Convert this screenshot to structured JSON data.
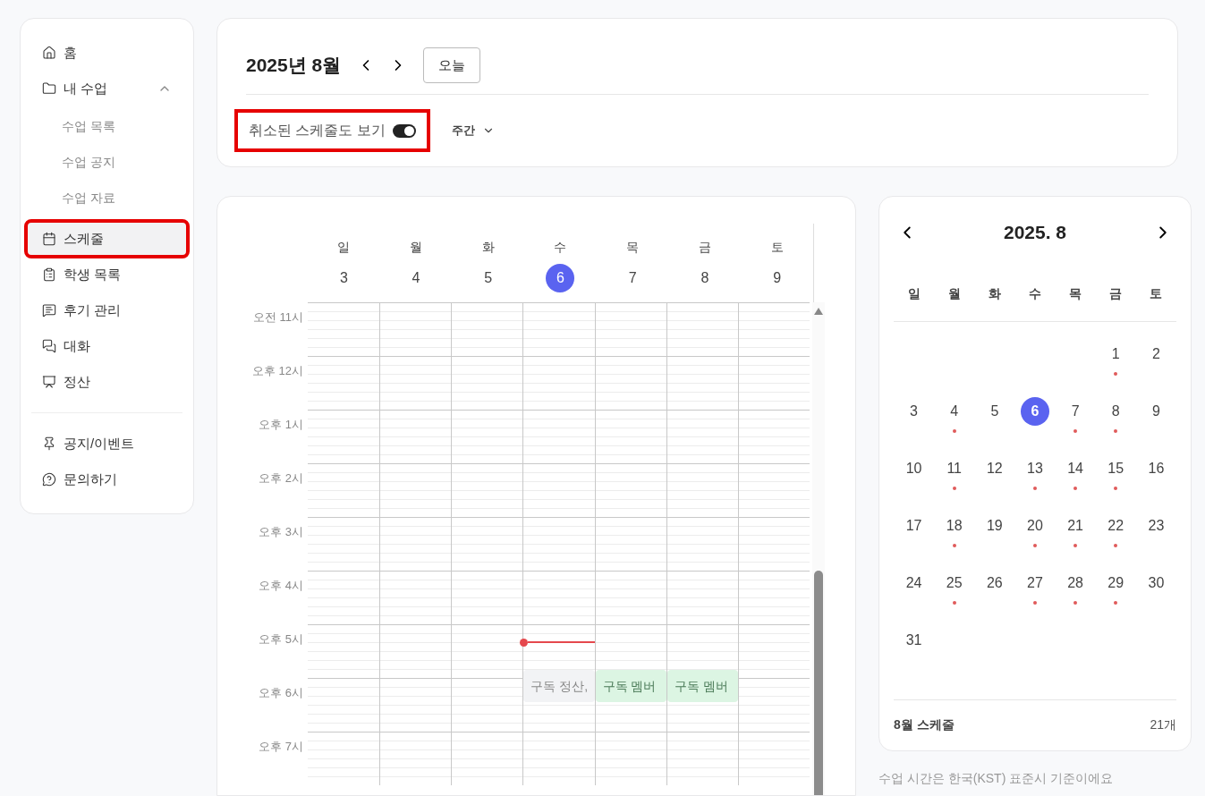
{
  "sidebar": {
    "items": [
      {
        "label": "홈",
        "selected": false,
        "highlighted": false
      },
      {
        "label": "내 수업",
        "selected": false,
        "highlighted": false,
        "expanded": true,
        "children": [
          {
            "label": "수업 목록"
          },
          {
            "label": "수업 공지"
          },
          {
            "label": "수업 자료"
          }
        ]
      },
      {
        "label": "스케줄",
        "selected": true,
        "highlighted": true
      },
      {
        "label": "학생 목록",
        "selected": false,
        "highlighted": false
      },
      {
        "label": "후기 관리",
        "selected": false,
        "highlighted": false
      },
      {
        "label": "대화",
        "selected": false,
        "highlighted": false
      },
      {
        "label": "정산",
        "selected": false,
        "highlighted": false
      }
    ],
    "bottom_items": [
      {
        "label": "공지/이벤트",
        "selected": false
      },
      {
        "label": "문의하기",
        "selected": false
      }
    ]
  },
  "toolbar": {
    "title": "2025년 8월",
    "today_button": "오늘",
    "cancelled_toggle": {
      "label": "취소된 스케줄도 보기",
      "on": true,
      "highlighted": true
    },
    "view_select": "주간"
  },
  "week": {
    "days": [
      {
        "weekday": "일",
        "date": "3",
        "selected": false
      },
      {
        "weekday": "월",
        "date": "4",
        "selected": false
      },
      {
        "weekday": "화",
        "date": "5",
        "selected": false
      },
      {
        "weekday": "수",
        "date": "6",
        "selected": true
      },
      {
        "weekday": "목",
        "date": "7",
        "selected": false
      },
      {
        "weekday": "금",
        "date": "8",
        "selected": false
      },
      {
        "weekday": "토",
        "date": "9",
        "selected": false
      }
    ],
    "hours": [
      {
        "label": "오전 11시"
      },
      {
        "label": "오후 12시"
      },
      {
        "label": "오후 1시"
      },
      {
        "label": "오후 2시"
      },
      {
        "label": "오후 3시"
      },
      {
        "label": "오후 4시"
      },
      {
        "label": "오후 5시",
        "cells": [
          null,
          null,
          null,
          {
            "now_line": true,
            "event": {
              "text": "구독 정산,",
              "kind": "cancelled"
            }
          },
          {
            "event": {
              "text": "구독 멤버",
              "kind": "active"
            }
          },
          {
            "event": {
              "text": "구독 멤버",
              "kind": "active"
            }
          },
          null
        ]
      },
      {
        "label": "오후 6시"
      },
      {
        "label": "오후 7시"
      }
    ]
  },
  "mini_calendar": {
    "title": "2025. 8",
    "weekdays": [
      "일",
      "월",
      "화",
      "수",
      "목",
      "금",
      "토"
    ],
    "weeks": [
      [
        {
          "kind": "blank"
        },
        {
          "kind": "blank"
        },
        {
          "kind": "blank"
        },
        {
          "kind": "blank"
        },
        {
          "kind": "blank"
        },
        {
          "kind": "day",
          "day": "1",
          "dot": true,
          "selected": false
        },
        {
          "kind": "day",
          "day": "2",
          "dot": false,
          "selected": false
        }
      ],
      [
        {
          "kind": "day",
          "day": "3",
          "dot": false,
          "selected": false
        },
        {
          "kind": "day",
          "day": "4",
          "dot": true,
          "selected": false
        },
        {
          "kind": "day",
          "day": "5",
          "dot": false,
          "selected": false
        },
        {
          "kind": "day",
          "day": "6",
          "dot": false,
          "selected": true
        },
        {
          "kind": "day",
          "day": "7",
          "dot": true,
          "selected": false
        },
        {
          "kind": "day",
          "day": "8",
          "dot": true,
          "selected": false
        },
        {
          "kind": "day",
          "day": "9",
          "dot": false,
          "selected": false
        }
      ],
      [
        {
          "kind": "day",
          "day": "10",
          "dot": false,
          "selected": false
        },
        {
          "kind": "day",
          "day": "11",
          "dot": true,
          "selected": false
        },
        {
          "kind": "day",
          "day": "12",
          "dot": false,
          "selected": false
        },
        {
          "kind": "day",
          "day": "13",
          "dot": true,
          "selected": false
        },
        {
          "kind": "day",
          "day": "14",
          "dot": true,
          "selected": false
        },
        {
          "kind": "day",
          "day": "15",
          "dot": true,
          "selected": false
        },
        {
          "kind": "day",
          "day": "16",
          "dot": false,
          "selected": false
        }
      ],
      [
        {
          "kind": "day",
          "day": "17",
          "dot": false,
          "selected": false
        },
        {
          "kind": "day",
          "day": "18",
          "dot": true,
          "selected": false
        },
        {
          "kind": "day",
          "day": "19",
          "dot": false,
          "selected": false
        },
        {
          "kind": "day",
          "day": "20",
          "dot": true,
          "selected": false
        },
        {
          "kind": "day",
          "day": "21",
          "dot": true,
          "selected": false
        },
        {
          "kind": "day",
          "day": "22",
          "dot": true,
          "selected": false
        },
        {
          "kind": "day",
          "day": "23",
          "dot": false,
          "selected": false
        }
      ],
      [
        {
          "kind": "day",
          "day": "24",
          "dot": false,
          "selected": false
        },
        {
          "kind": "day",
          "day": "25",
          "dot": true,
          "selected": false
        },
        {
          "kind": "day",
          "day": "26",
          "dot": false,
          "selected": false
        },
        {
          "kind": "day",
          "day": "27",
          "dot": true,
          "selected": false
        },
        {
          "kind": "day",
          "day": "28",
          "dot": true,
          "selected": false
        },
        {
          "kind": "day",
          "day": "29",
          "dot": true,
          "selected": false
        },
        {
          "kind": "day",
          "day": "30",
          "dot": false,
          "selected": false
        }
      ],
      [
        {
          "kind": "day",
          "day": "31",
          "dot": false,
          "selected": false
        },
        {
          "kind": "blank"
        },
        {
          "kind": "blank"
        },
        {
          "kind": "blank"
        },
        {
          "kind": "blank"
        },
        {
          "kind": "blank"
        },
        {
          "kind": "blank"
        }
      ]
    ],
    "summary_label": "8월 스케줄",
    "summary_count": "21개"
  },
  "timezone_note": "수업 시간은 한국(KST) 표준시 기준이에요"
}
